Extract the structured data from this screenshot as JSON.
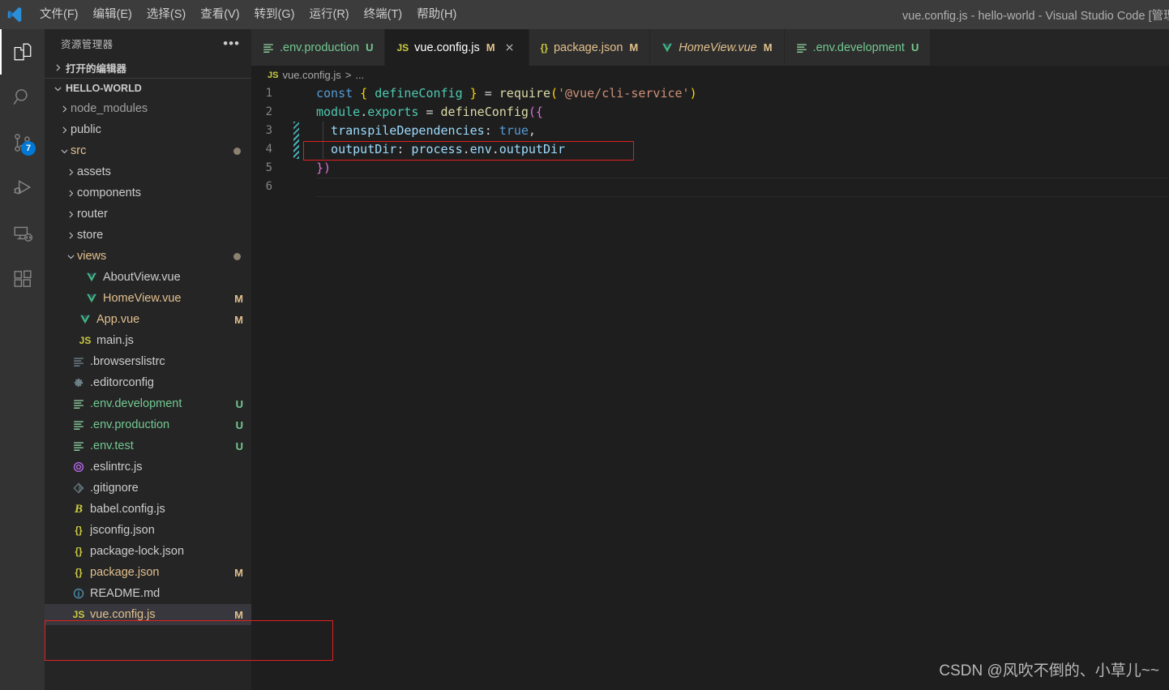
{
  "window": {
    "title": "vue.config.js - hello-world - Visual Studio Code [管理员]",
    "logo_icon": "vscode-logo-icon"
  },
  "menubar": {
    "items": [
      {
        "label": "文件(F)",
        "name": "menu-file"
      },
      {
        "label": "编辑(E)",
        "name": "menu-edit"
      },
      {
        "label": "选择(S)",
        "name": "menu-selection"
      },
      {
        "label": "查看(V)",
        "name": "menu-view"
      },
      {
        "label": "转到(G)",
        "name": "menu-goto"
      },
      {
        "label": "运行(R)",
        "name": "menu-run"
      },
      {
        "label": "终端(T)",
        "name": "menu-terminal"
      },
      {
        "label": "帮助(H)",
        "name": "menu-help"
      }
    ]
  },
  "activitybar": {
    "items": [
      {
        "icon": "files-explorer-icon",
        "active": true,
        "badge": ""
      },
      {
        "icon": "search-icon",
        "active": false,
        "badge": ""
      },
      {
        "icon": "source-control-icon",
        "active": false,
        "badge": "7"
      },
      {
        "icon": "run-and-debug-icon",
        "active": false,
        "badge": ""
      },
      {
        "icon": "remote-explorer-icon",
        "active": false,
        "badge": ""
      },
      {
        "icon": "extensions-icon",
        "active": false,
        "badge": ""
      }
    ],
    "badge_color": "#0078d4"
  },
  "sidebar": {
    "title": "资源管理器",
    "overflow_label": "•••",
    "open_editors": {
      "label": "打开的编辑器",
      "expanded": false
    },
    "workspace": {
      "label": "HELLO-WORLD",
      "expanded": true
    },
    "tree": [
      {
        "label": "node_modules",
        "indent": 1,
        "twisty": "chevron-right",
        "icon": "",
        "icon_class": "",
        "color": "c-dim",
        "badge": "",
        "dot": false,
        "selected": false
      },
      {
        "label": "public",
        "indent": 1,
        "twisty": "chevron-right",
        "icon": "",
        "icon_class": "",
        "color": "c-default",
        "badge": "",
        "dot": false,
        "selected": false
      },
      {
        "label": "src",
        "indent": 1,
        "twisty": "chevron-down",
        "icon": "",
        "icon_class": "",
        "color": "c-modified",
        "badge": "",
        "dot": true,
        "selected": false
      },
      {
        "label": "assets",
        "indent": 2,
        "twisty": "chevron-right",
        "icon": "",
        "icon_class": "",
        "color": "c-default",
        "badge": "",
        "dot": false,
        "selected": false
      },
      {
        "label": "components",
        "indent": 2,
        "twisty": "chevron-right",
        "icon": "",
        "icon_class": "",
        "color": "c-default",
        "badge": "",
        "dot": false,
        "selected": false
      },
      {
        "label": "router",
        "indent": 2,
        "twisty": "chevron-right",
        "icon": "",
        "icon_class": "",
        "color": "c-default",
        "badge": "",
        "dot": false,
        "selected": false
      },
      {
        "label": "store",
        "indent": 2,
        "twisty": "chevron-right",
        "icon": "",
        "icon_class": "",
        "color": "c-default",
        "badge": "",
        "dot": false,
        "selected": false
      },
      {
        "label": "views",
        "indent": 2,
        "twisty": "chevron-down",
        "icon": "",
        "icon_class": "",
        "color": "c-modified",
        "badge": "",
        "dot": true,
        "selected": false
      },
      {
        "label": "AboutView.vue",
        "indent": 3,
        "twisty": "",
        "icon": "vue",
        "icon_class": "i-vue",
        "color": "c-default",
        "badge": "",
        "dot": false,
        "selected": false
      },
      {
        "label": "HomeView.vue",
        "indent": 3,
        "twisty": "",
        "icon": "vue",
        "icon_class": "i-vue",
        "color": "c-modified",
        "badge": "M",
        "dot": false,
        "selected": false
      },
      {
        "label": "App.vue",
        "indent": 2,
        "twisty": "",
        "icon": "vue",
        "icon_class": "i-vue",
        "color": "c-modified",
        "badge": "M",
        "dot": false,
        "selected": false
      },
      {
        "label": "main.js",
        "indent": 2,
        "twisty": "",
        "icon": "JS",
        "icon_class": "i-js",
        "color": "c-default",
        "badge": "",
        "dot": false,
        "selected": false
      },
      {
        "label": ".browserslistrc",
        "indent": 1,
        "twisty": "",
        "icon": "cfg",
        "icon_class": "i-cfg",
        "color": "c-default",
        "badge": "",
        "dot": false,
        "selected": false
      },
      {
        "label": ".editorconfig",
        "indent": 1,
        "twisty": "",
        "icon": "gear",
        "icon_class": "i-gear",
        "color": "c-default",
        "badge": "",
        "dot": false,
        "selected": false
      },
      {
        "label": ".env.development",
        "indent": 1,
        "twisty": "",
        "icon": "cfg",
        "icon_class": "i-env",
        "color": "c-untracked",
        "badge": "U",
        "dot": false,
        "selected": false
      },
      {
        "label": ".env.production",
        "indent": 1,
        "twisty": "",
        "icon": "cfg",
        "icon_class": "i-env",
        "color": "c-untracked",
        "badge": "U",
        "dot": false,
        "selected": false
      },
      {
        "label": ".env.test",
        "indent": 1,
        "twisty": "",
        "icon": "cfg",
        "icon_class": "i-env",
        "color": "c-untracked",
        "badge": "U",
        "dot": false,
        "selected": false
      },
      {
        "label": ".eslintrc.js",
        "indent": 1,
        "twisty": "",
        "icon": "eslint",
        "icon_class": "i-eslint",
        "color": "c-default",
        "badge": "",
        "dot": false,
        "selected": false
      },
      {
        "label": ".gitignore",
        "indent": 1,
        "twisty": "",
        "icon": "git",
        "icon_class": "i-git",
        "color": "c-default",
        "badge": "",
        "dot": false,
        "selected": false
      },
      {
        "label": "babel.config.js",
        "indent": 1,
        "twisty": "",
        "icon": "B",
        "icon_class": "i-babel",
        "color": "c-default",
        "badge": "",
        "dot": false,
        "selected": false
      },
      {
        "label": "jsconfig.json",
        "indent": 1,
        "twisty": "",
        "icon": "{}",
        "icon_class": "i-json",
        "color": "c-default",
        "badge": "",
        "dot": false,
        "selected": false
      },
      {
        "label": "package-lock.json",
        "indent": 1,
        "twisty": "",
        "icon": "{}",
        "icon_class": "i-json",
        "color": "c-default",
        "badge": "",
        "dot": false,
        "selected": false
      },
      {
        "label": "package.json",
        "indent": 1,
        "twisty": "",
        "icon": "{}",
        "icon_class": "i-json",
        "color": "c-modified",
        "badge": "M",
        "dot": false,
        "selected": false
      },
      {
        "label": "README.md",
        "indent": 1,
        "twisty": "",
        "icon": "md",
        "icon_class": "i-md",
        "color": "c-default",
        "badge": "",
        "dot": false,
        "selected": false
      },
      {
        "label": "vue.config.js",
        "indent": 1,
        "twisty": "",
        "icon": "JS",
        "icon_class": "i-js",
        "color": "c-modified",
        "badge": "M",
        "dot": false,
        "selected": true
      }
    ]
  },
  "tabs": [
    {
      "label": ".env.production",
      "icon": "cfg",
      "icon_class": "i-env",
      "badge": "U",
      "badge_class": "c-untracked",
      "label_class": "c-untracked",
      "active": false,
      "italic": false,
      "close": false
    },
    {
      "label": "vue.config.js",
      "icon": "JS",
      "icon_class": "i-js",
      "badge": "M",
      "badge_class": "c-modified",
      "label_class": "",
      "active": true,
      "italic": false,
      "close": true
    },
    {
      "label": "package.json",
      "icon": "{}",
      "icon_class": "i-json",
      "badge": "M",
      "badge_class": "c-modified",
      "label_class": "c-modified",
      "active": false,
      "italic": false,
      "close": false
    },
    {
      "label": "HomeView.vue",
      "icon": "vue",
      "icon_class": "i-vue",
      "badge": "M",
      "badge_class": "c-modified",
      "label_class": "c-modified",
      "active": false,
      "italic": true,
      "close": false
    },
    {
      "label": ".env.development",
      "icon": "cfg",
      "icon_class": "i-env",
      "badge": "U",
      "badge_class": "c-untracked",
      "label_class": "c-untracked",
      "active": false,
      "italic": false,
      "close": false
    }
  ],
  "breadcrumb": {
    "file_icon": "JS",
    "file": "vue.config.js",
    "separator": ">",
    "rest": "..."
  },
  "editor": {
    "lines": [
      {
        "n": "1"
      },
      {
        "n": "2"
      },
      {
        "n": "3"
      },
      {
        "n": "4"
      },
      {
        "n": "5"
      },
      {
        "n": "6"
      }
    ],
    "code": {
      "l1_const": "const",
      "l1_brace_open": " { ",
      "l1_defineConfig": "defineConfig",
      "l1_brace_close": " } ",
      "l1_eq": "= ",
      "l1_require": "require",
      "l1_paren_open": "(",
      "l1_string": "'@vue/cli-service'",
      "l1_paren_close": ")",
      "l2_module": "module",
      "l2_dot": ".",
      "l2_exports": "exports",
      "l2_eq": " = ",
      "l2_defineConfig": "defineConfig",
      "l2_open": "({",
      "l3_prop": "  transpileDependencies",
      "l3_colon": ": ",
      "l3_true": "true",
      "l3_comma": ",",
      "l4_prop": "  outputDir",
      "l4_colon": ": ",
      "l4_process": "process",
      "l4_dot1": ".",
      "l4_env": "env",
      "l4_dot2": ".",
      "l4_outputDir": "outputDir",
      "l5_close": "})"
    }
  },
  "annotations": {
    "code_box_color": "#e02020",
    "file_box_color": "#e02020"
  },
  "watermark": "CSDN @风吹不倒的、小草儿~~"
}
